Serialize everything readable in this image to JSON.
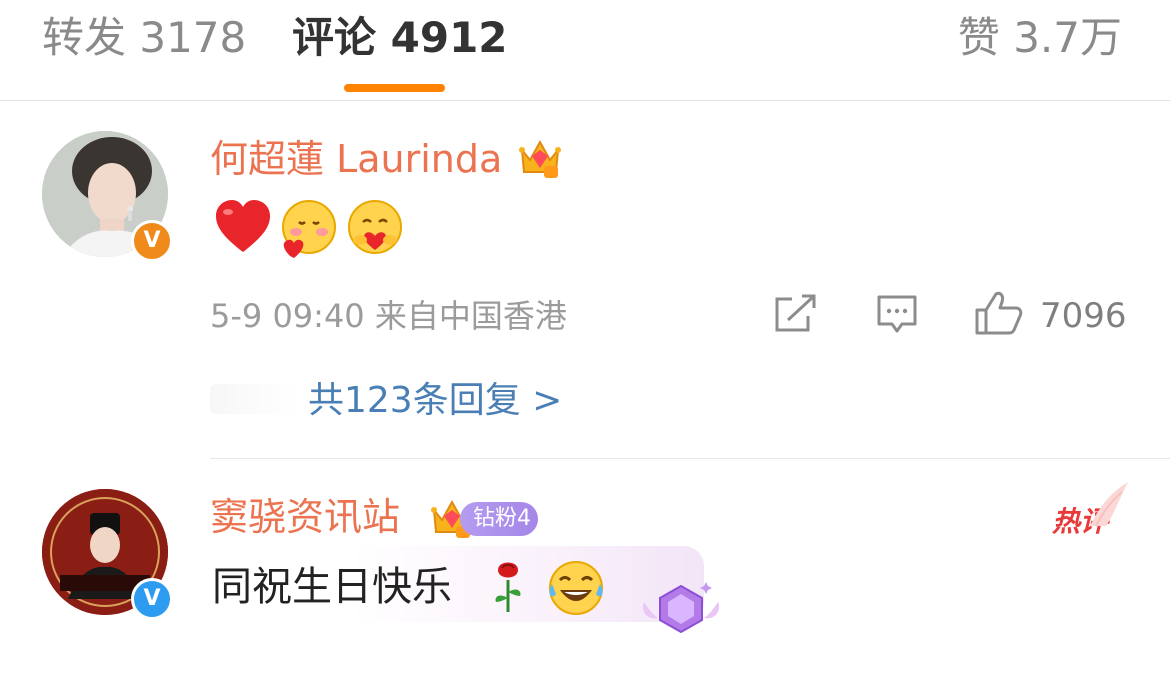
{
  "tabs": {
    "forward": "转发 3178",
    "comment": "评论 4912",
    "like": "赞 3.7万"
  },
  "colors": {
    "accent": "#ff8200",
    "username": "#eb7350",
    "link": "#4a7fb5",
    "verified_orange": "#f08a1a",
    "verified_blue": "#2d9cf0",
    "hot": "#e83a3a"
  },
  "comments": [
    {
      "username": "何超蓮 Laurinda",
      "verified_mark": "V",
      "emojis": [
        "heart",
        "cute-blush-heart-face",
        "hugging-face"
      ],
      "time": "5-9 09:40 来自中国香港",
      "like_count": "7096",
      "replies": "共123条回复 >"
    },
    {
      "username": "窦骁资讯站",
      "verified_mark": "V",
      "fan_badge": "钻粉4",
      "hot_tag": "热评",
      "text": "同祝生日快乐",
      "emojis": [
        "rose",
        "tears-of-joy-face"
      ]
    }
  ]
}
